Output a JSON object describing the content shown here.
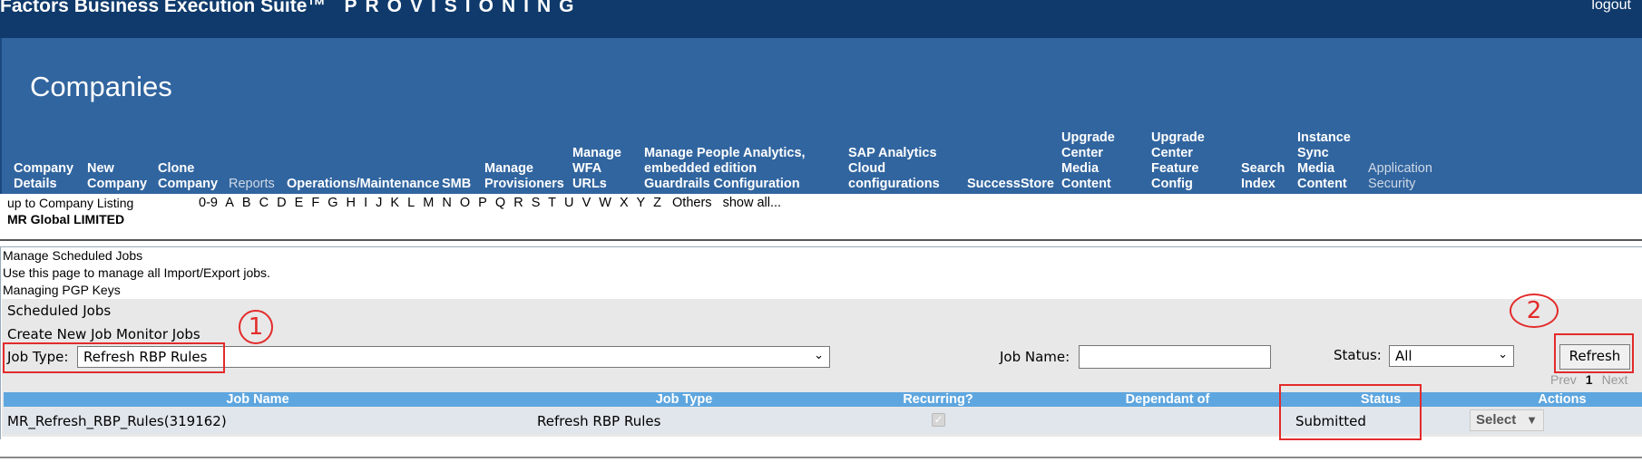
{
  "header": {
    "app_title": "Factors Business Execution Suite™",
    "app_subtitle": "PROVISIONING",
    "logout": "logout",
    "page_title": "Companies"
  },
  "nav": {
    "company_details": "Company Details",
    "new_company": "New Company",
    "clone_company": "Clone Company",
    "reports": "Reports",
    "ops": "Operations/Maintenance",
    "smb": "SMB",
    "manage_provisioners": "Manage Provisioners",
    "manage_wfa": "Manage WFA URLs",
    "people_analytics": "Manage People Analytics, embedded edition Guardrails Configuration",
    "sap_analytics": "SAP Analytics Cloud configurations",
    "successstore": "SuccessStore",
    "uc_media": "Upgrade Center Media Content",
    "uc_feature": "Upgrade Center Feature Config",
    "search_index": "Search Index",
    "instance_sync": "Instance Sync Media Content",
    "app_security": "Application Security"
  },
  "listing": {
    "up_link": "up to Company Listing",
    "company_name": "MR Global LIMITED",
    "letters": [
      "0-9",
      "A",
      "B",
      "C",
      "D",
      "E",
      "F",
      "G",
      "H",
      "I",
      "J",
      "K",
      "L",
      "M",
      "N",
      "O",
      "P",
      "Q",
      "R",
      "S",
      "T",
      "U",
      "V",
      "W",
      "X",
      "Y",
      "Z"
    ],
    "others": "Others",
    "show_all": "show all..."
  },
  "info": {
    "line1": "Manage Scheduled Jobs",
    "line2": "Use this page to manage all Import/Export jobs.",
    "line3": "Managing PGP Keys"
  },
  "panel": {
    "title": "Scheduled Jobs",
    "create_link": "Create New Job Monitor Jobs",
    "job_type_label": "Job Type:",
    "job_type_value": "Refresh RBP Rules",
    "job_name_label": "Job Name:",
    "job_name_value": "",
    "status_label": "Status:",
    "status_value": "All",
    "refresh_button": "Refresh"
  },
  "pager": {
    "prev": "Prev",
    "page": "1",
    "next": "Next"
  },
  "table": {
    "headers": [
      "Job Name",
      "Job Type",
      "Recurring?",
      "Dependant of",
      "Status",
      "Actions"
    ],
    "rows": [
      {
        "job_name": "MR_Refresh_RBP_Rules(319162)",
        "job_type": "Refresh RBP Rules",
        "recurring": true,
        "dependant": "",
        "status": "Submitted",
        "action": "Select"
      }
    ]
  },
  "annotations": {
    "marker1": "1",
    "marker2": "2",
    "color": "#e32b2b"
  },
  "colors": {
    "topbar": "#0f3a6b",
    "header": "#31659f",
    "table_header": "#5ea6df"
  }
}
